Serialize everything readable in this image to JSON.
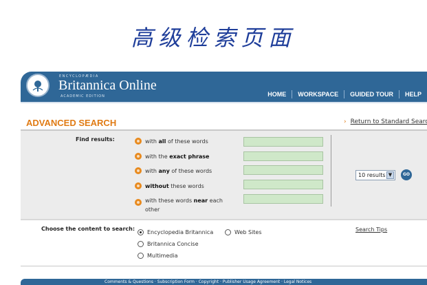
{
  "page_title": "高级检索页面",
  "header": {
    "brand_small": "ENCYCLOPÆDIA",
    "brand_name": "Britannica Online",
    "edition": "ACADEMIC EDITION",
    "nav": [
      "HOME",
      "WORKSPACE",
      "GUIDED TOUR",
      "HELP"
    ]
  },
  "search": {
    "title": "ADVANCED SEARCH",
    "return_link": "Return to Standard Search",
    "find_label": "Find results:",
    "options": [
      {
        "pre": "with ",
        "bold": "all",
        "post": " of these words"
      },
      {
        "pre": "with the ",
        "bold": "exact phrase",
        "post": ""
      },
      {
        "pre": "with ",
        "bold": "any",
        "post": " of these words"
      },
      {
        "pre": "",
        "bold": "without",
        "post": " these words"
      },
      {
        "pre": "with these words ",
        "bold": "near",
        "post": " each other"
      }
    ],
    "results_select": "10 results",
    "go_label": "GO"
  },
  "content": {
    "label": "Choose the content to search:",
    "options": [
      {
        "label": "Encyclopedia Britannica",
        "checked": true
      },
      {
        "label": "Web Sites",
        "checked": false
      },
      {
        "label": "Britannica Concise",
        "checked": false
      },
      {
        "label": "Multimedia",
        "checked": false
      }
    ],
    "search_tips": "Search Tips"
  },
  "footer": {
    "text": "Comments & Questions · Subscription Form · Copyright · Publisher Usage Agreement · Legal Notices"
  },
  "colors": {
    "brand_blue": "#2f6797",
    "title_orange": "#e07b14",
    "field_green": "#cfe8c9",
    "page_title_blue": "#1f3e9a"
  }
}
